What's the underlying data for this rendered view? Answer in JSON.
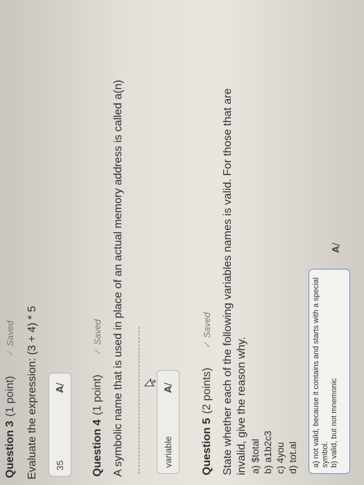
{
  "q3": {
    "title": "Question 3",
    "points": "(1 point)",
    "saved": "Saved",
    "prompt": "Evaluate the expression: (3 + 4) * 5",
    "answer": "35"
  },
  "q4": {
    "title": "Question 4",
    "points": "(1 point)",
    "saved": "Saved",
    "prompt": "A symbolic name that is used in place of an actual memory address is called a(n)",
    "answer": "variable"
  },
  "q5": {
    "title": "Question 5",
    "points": "(2 points)",
    "saved": "Saved",
    "prompt_line1": "State whether each of the following variables names is valid. For those that are",
    "prompt_line2": "invalid, give the reason why.",
    "items": [
      "a) $total",
      "b) a1b2c3",
      "c) 4you",
      "d) tot.al"
    ],
    "answer_lines": [
      "a) not valid, because it contains and starts with a special",
      "symbol.",
      "b) valid, but not mnemonic"
    ]
  },
  "icons": {
    "saved": "check-icon",
    "spellcheck": "spellcheck-icon",
    "cursor": "mouse-cursor-icon"
  },
  "colors": {
    "saved_check": "#86b27a",
    "focus_border": "#6f87c4"
  }
}
